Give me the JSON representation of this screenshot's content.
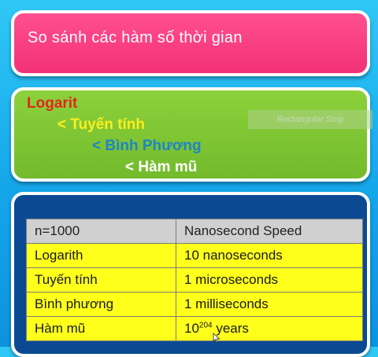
{
  "title": "So sánh các hàm số thời gian",
  "comparison": [
    "Logarit",
    "< Tuyến tính",
    "< Bình Phương",
    "< Hàm mũ"
  ],
  "snip_label": "Rectangular Snip",
  "table": {
    "header": [
      "n=1000",
      "Nanosecond Speed"
    ],
    "rows": [
      {
        "name": "Logarith",
        "value": "10 nanoseconds"
      },
      {
        "name": "Tuyến tính",
        "value": "1 microseconds"
      },
      {
        "name": "Bình phương",
        "value": "1 milliseconds"
      },
      {
        "name": "Hàm mũ",
        "value_base": "10",
        "value_exp": "204",
        "value_unit": " years"
      }
    ]
  },
  "colors": {
    "title_bg": "#f23175",
    "compare_bg": "#73bb2d",
    "logarit": "#e0271c",
    "linear": "#ffee1a",
    "quadratic": "#1e84c8",
    "exponential": "#ffffff",
    "table_bg": "#0b4a93",
    "row_bg": "#ffff1c",
    "header_bg": "#d0d0d0"
  },
  "icons": [
    "mouse-cursor-icon"
  ]
}
